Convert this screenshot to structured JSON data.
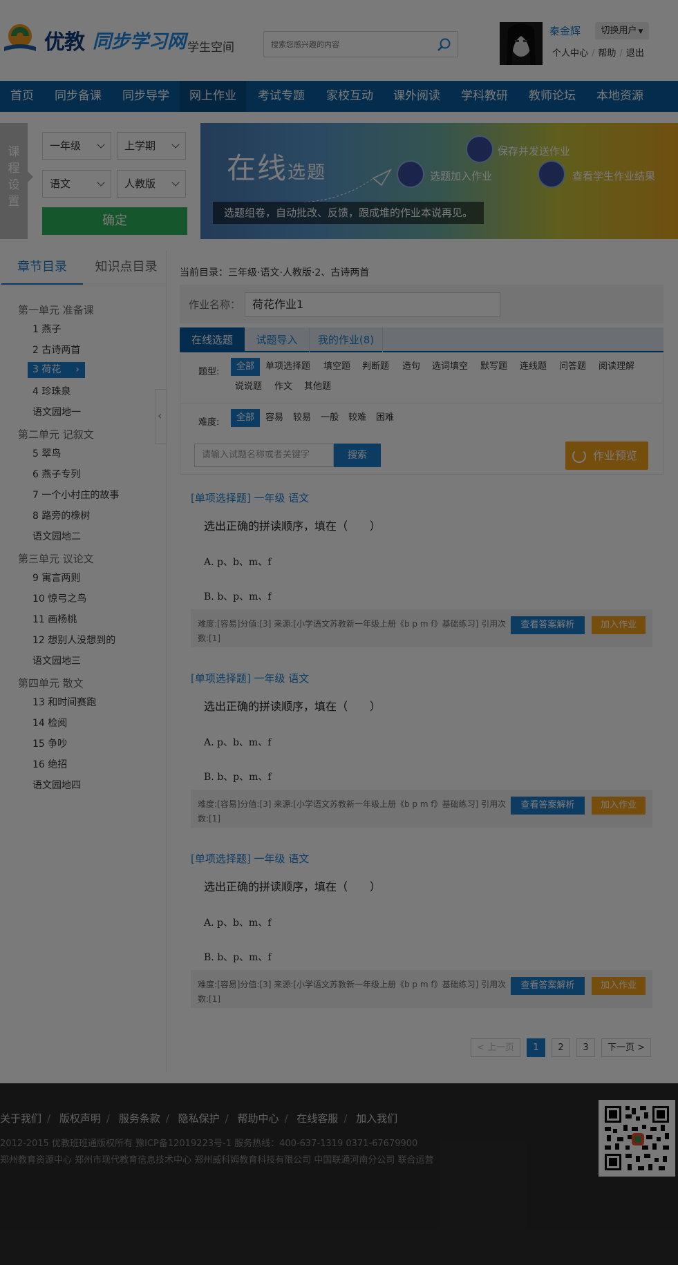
{
  "header": {
    "logo_brand": "优教",
    "logo_sub": "同步学习网",
    "space": "学生空间",
    "search_placeholder": "搜索您感兴趣的内容",
    "username": "秦金辉",
    "switch_user": "切换用户",
    "links": [
      "个人中心",
      "帮助",
      "退出"
    ]
  },
  "nav": [
    "首页",
    "同步备课",
    "同步导学",
    "网上作业",
    "考试专题",
    "家校互动",
    "课外阅读",
    "学科教研",
    "教师论坛",
    "本地资源"
  ],
  "course_settings": {
    "side_label": [
      "课",
      "程",
      "设",
      "置"
    ],
    "grade": "一年级",
    "term": "上学期",
    "subject": "语文",
    "edition": "人教版",
    "confirm": "确定"
  },
  "banner": {
    "title_big": "在线",
    "title_small": "选题",
    "f1": "选题加入作业",
    "f2": "保存并发送作业",
    "f3": "查看学生作业结果",
    "tagline": "选题组卷，自动批改、反馈，跟成堆的作业本说再见。"
  },
  "tree": {
    "tabs": [
      "章节目录",
      "知识点目录"
    ],
    "units": [
      {
        "title": "第一单元 准备课",
        "lessons": [
          "1 燕子",
          "2 古诗两首",
          "3 荷花",
          "4 珍珠泉",
          "语文园地一"
        ]
      },
      {
        "title": "第二单元 记叙文",
        "lessons": [
          "5 翠鸟",
          "6 燕子专列",
          "7 一个小村庄的故事",
          "8 路旁的橡树",
          "语文园地二"
        ]
      },
      {
        "title": "第三单元 议论文",
        "lessons": [
          "9 寓言两则",
          "10 惊弓之鸟",
          "11 画杨桃",
          "12 想别人没想到的",
          "语文园地三"
        ]
      },
      {
        "title": "第四单元 散文",
        "lessons": [
          "13 和时间赛跑",
          "14 检阅",
          "15 争吵",
          "16 绝招",
          "语文园地四"
        ]
      }
    ]
  },
  "main": {
    "breadcrumb": "当前目录：三年级·语文·人教版·2、古诗两首",
    "hw_label": "作业名称：",
    "hw_name": "荷花作业1",
    "tabs": [
      "在线选题",
      "试题导入",
      "我的作业(8)"
    ],
    "type_label": "题型:",
    "types": [
      "全部",
      "单项选择题",
      "填空题",
      "判断题",
      "造句",
      "选词填空",
      "默写题",
      "连线题",
      "问答题",
      "阅读理解",
      "说说题",
      "作文",
      "其他题"
    ],
    "diff_label": "难度:",
    "diffs": [
      "全部",
      "容易",
      "较易",
      "一般",
      "较难",
      "困难"
    ],
    "kw_placeholder": "请输入试题名称或者关键字",
    "search_btn": "搜索",
    "preview_btn": "作业预览"
  },
  "questions": [
    {
      "head": "[单项选择题] 一年级 语文",
      "stem": "选出正确的拼读顺序，填在（　　）",
      "a": "A. p、b、m、f",
      "b": "B. b、p、m、f",
      "meta": "难度:[容易]分值:[3] 来源:[小学语文苏教新一年级上册《b p m f》基础练习] 引用次数:[1]",
      "ans": "查看答案解析",
      "add": "加入作业"
    },
    {
      "head": "[单项选择题] 一年级 语文",
      "stem": "选出正确的拼读顺序，填在（　　）",
      "a": "A. p、b、m、f",
      "b": "B. b、p、m、f",
      "meta": "难度:[容易]分值:[3] 来源:[小学语文苏教新一年级上册《b p m f》基础练习] 引用次数:[1]",
      "ans": "查看答案解析",
      "add": "加入作业"
    },
    {
      "head": "[单项选择题] 一年级 语文",
      "stem": "选出正确的拼读顺序，填在（　　）",
      "a": "A. p、b、m、f",
      "b": "B. b、p、m、f",
      "meta": "难度:[容易]分值:[3] 来源:[小学语文苏教新一年级上册《b p m f》基础练习] 引用次数:[1]",
      "ans": "查看答案解析",
      "add": "加入作业"
    }
  ],
  "pager": {
    "prev": "< 上一页",
    "pages": [
      "1",
      "2",
      "3"
    ],
    "next": "下一页 >"
  },
  "footer": {
    "links": [
      "关于我们",
      "版权声明",
      "服务条款",
      "隐私保护",
      "帮助中心",
      "在线客服",
      "加入我们"
    ],
    "line2": "2012-2015 优教班班通版权所有  豫ICP备12019223号-1     服务热线：400-637-1319   0371-67679900",
    "line3": "郑州教育资源中心    郑州市现代教育信息技术中心   郑州威科姆教育科技有限公司 中国联通河南分公司  联合运营"
  },
  "colors": {
    "nav": "#0a5fa2",
    "accent": "#1c7ed0",
    "green": "#2fb55e",
    "orange": "#f4a11a",
    "footer": "#2b2b2b"
  }
}
